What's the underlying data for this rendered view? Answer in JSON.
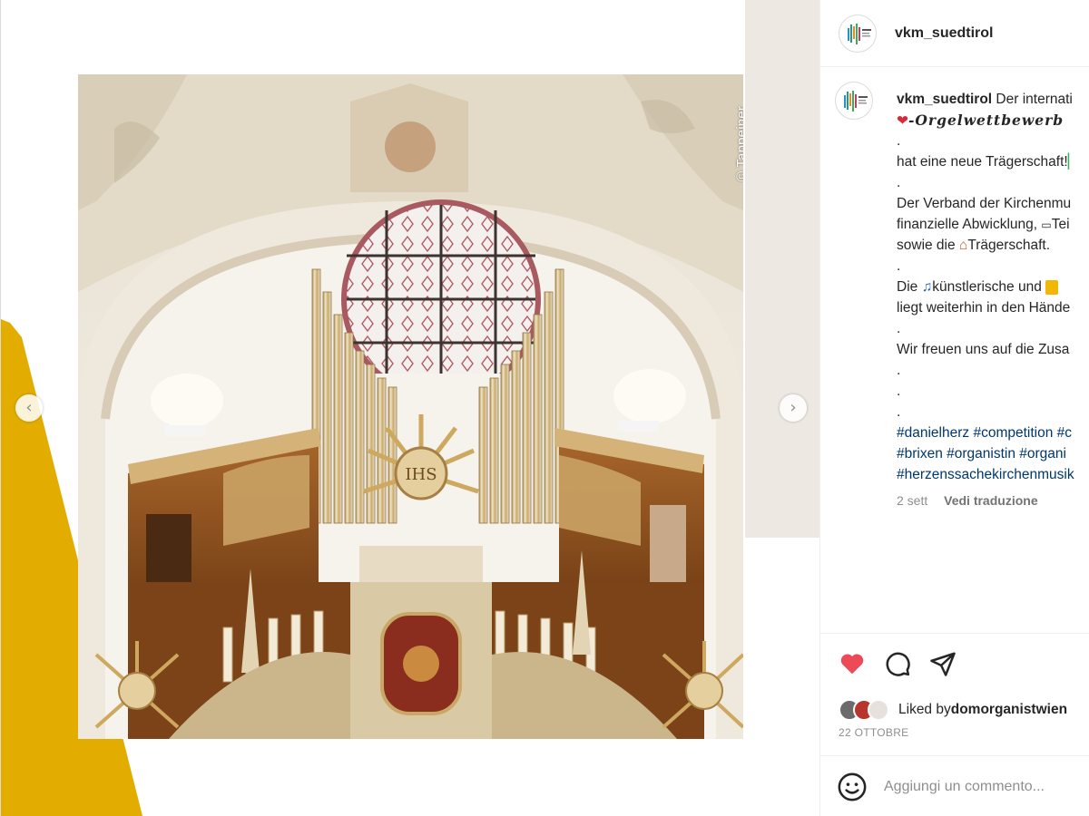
{
  "post": {
    "username": "vkm_suedtirol",
    "photo_credit": "© Tappeiner",
    "caption": {
      "line1": "Der internati",
      "line2": "-Orgelwettbewerb",
      "line3": "hat eine neue Trägerschaft!",
      "line4": "Der Verband der Kirchenmu",
      "line5": "finanzielle Abwicklung, ",
      "line5b": "Tei",
      "line6": "sowie die ",
      "line6b": "Trägerschaft.",
      "line7": "Die ",
      "line7b": "künstlerische und ",
      "line8": "liegt weiterhin in den Hände",
      "line9": "Wir freuen uns auf die Zusa",
      "dot": ".",
      "tags1": "#danielherz #competition #c",
      "tags2": "#brixen #organistin #organi",
      "tags3": "#herzenssachekirchenmusik"
    },
    "time_ago": "2 sett",
    "translate_label": "Vedi traduzione",
    "liked_prefix": "Liked by",
    "liked_user": "domorganistwien",
    "date": "22 OTTOBRE",
    "comment_placeholder": "Aggiungi un commento..."
  },
  "icons": {
    "prev": "chevron-left-icon",
    "next": "chevron-right-icon",
    "like": "heart-icon",
    "comment": "comment-icon",
    "share": "send-icon",
    "emoji": "emoji-icon"
  },
  "colors": {
    "like": "#ed4956",
    "hashtag": "#00376b",
    "meta": "#8e8e8e",
    "accent_yellow": "#e3ad00"
  }
}
